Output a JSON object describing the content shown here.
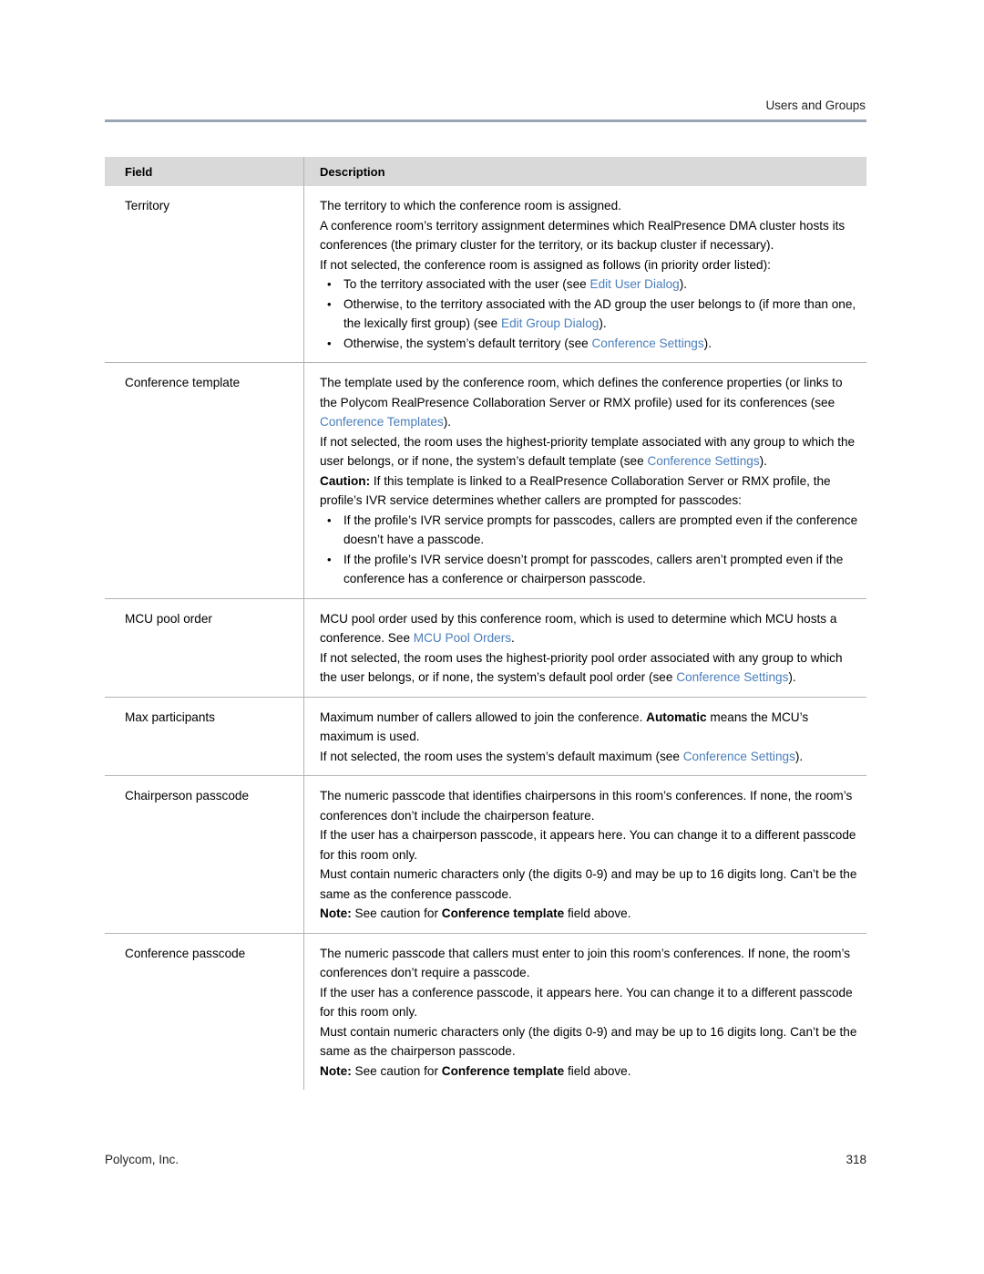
{
  "header": {
    "section_title": "Users and Groups"
  },
  "table": {
    "columns": [
      "Field",
      "Description"
    ],
    "rows": [
      {
        "field": "Territory",
        "blocks": [
          {
            "type": "p",
            "runs": [
              {
                "t": "The territory to which the conference room is assigned."
              }
            ]
          },
          {
            "type": "p",
            "runs": [
              {
                "t": "A conference room’s territory assignment determines which RealPresence DMA cluster hosts its conferences (the primary cluster for the territory, or its backup cluster if necessary)."
              }
            ]
          },
          {
            "type": "p",
            "runs": [
              {
                "t": "If not selected, the conference room is assigned as follows (in priority order listed):"
              }
            ]
          },
          {
            "type": "ul",
            "items": [
              {
                "runs": [
                  {
                    "t": "To the territory associated with the user (see "
                  },
                  {
                    "t": "Edit User Dialog",
                    "style": "link"
                  },
                  {
                    "t": ")."
                  }
                ]
              },
              {
                "runs": [
                  {
                    "t": "Otherwise, to the territory associated with the AD group the user belongs to (if more than one, the lexically first group) (see "
                  },
                  {
                    "t": "Edit Group Dialog",
                    "style": "link"
                  },
                  {
                    "t": ")."
                  }
                ]
              },
              {
                "runs": [
                  {
                    "t": "Otherwise, the system’s default territory (see "
                  },
                  {
                    "t": "Conference Settings",
                    "style": "link"
                  },
                  {
                    "t": ")."
                  }
                ]
              }
            ]
          }
        ]
      },
      {
        "field": "Conference template",
        "blocks": [
          {
            "type": "p",
            "runs": [
              {
                "t": "The template used by the conference room, which defines the conference properties (or links to the Polycom RealPresence Collaboration Server or RMX profile) used for its conferences (see "
              },
              {
                "t": "Conference Templates",
                "style": "link"
              },
              {
                "t": ")."
              }
            ]
          },
          {
            "type": "p",
            "runs": [
              {
                "t": "If not selected, the room uses the highest-priority template associated with any group to which the user belongs, or if none, the system’s default template (see "
              },
              {
                "t": "Conference Settings",
                "style": "link"
              },
              {
                "t": ")."
              }
            ]
          },
          {
            "type": "p",
            "runs": [
              {
                "t": "Caution:",
                "style": "bold"
              },
              {
                "t": " If this template is linked to a RealPresence Collaboration Server or RMX profile, the profile’s IVR service determines whether callers are prompted for passcodes:"
              }
            ]
          },
          {
            "type": "ul",
            "items": [
              {
                "runs": [
                  {
                    "t": "If the profile’s IVR service prompts for passcodes, callers are prompted even if the conference doesn’t have a passcode."
                  }
                ]
              },
              {
                "runs": [
                  {
                    "t": "If the profile’s IVR service doesn’t prompt for passcodes, callers aren’t prompted even if the conference has a conference or chairperson passcode."
                  }
                ]
              }
            ]
          }
        ]
      },
      {
        "field": "MCU pool order",
        "blocks": [
          {
            "type": "p",
            "runs": [
              {
                "t": "MCU pool order used by this conference room, which is used to determine which MCU hosts a conference. See "
              },
              {
                "t": "MCU Pool Orders",
                "style": "link"
              },
              {
                "t": "."
              }
            ]
          },
          {
            "type": "p",
            "runs": [
              {
                "t": "If not selected, the room uses the highest-priority pool order associated with any group to which the user belongs, or if none, the system’s default pool order (see "
              },
              {
                "t": "Conference Settings",
                "style": "link"
              },
              {
                "t": ")."
              }
            ]
          }
        ]
      },
      {
        "field": "Max participants",
        "blocks": [
          {
            "type": "p",
            "runs": [
              {
                "t": "Maximum number of callers allowed to join the conference. "
              },
              {
                "t": "Automatic",
                "style": "bold"
              },
              {
                "t": " means the MCU’s maximum is used."
              }
            ]
          },
          {
            "type": "p",
            "runs": [
              {
                "t": "If not selected, the room uses the system’s default maximum (see "
              },
              {
                "t": "Conference Settings",
                "style": "link"
              },
              {
                "t": ")."
              }
            ]
          }
        ]
      },
      {
        "field": "Chairperson passcode",
        "blocks": [
          {
            "type": "p",
            "runs": [
              {
                "t": "The numeric passcode that identifies chairpersons in this room’s conferences. If none, the room’s conferences don’t include the chairperson feature."
              }
            ]
          },
          {
            "type": "p",
            "runs": [
              {
                "t": "If the user has a chairperson passcode, it appears here. You can change it to a different passcode for this room only."
              }
            ]
          },
          {
            "type": "p",
            "runs": [
              {
                "t": "Must contain numeric characters only (the digits 0-9) and may be up to 16 digits long. Can’t be the same as the conference passcode."
              }
            ]
          },
          {
            "type": "p",
            "runs": [
              {
                "t": "Note:",
                "style": "bold"
              },
              {
                "t": " See caution for "
              },
              {
                "t": "Conference template",
                "style": "bold"
              },
              {
                "t": " field above."
              }
            ]
          }
        ]
      },
      {
        "field": "Conference passcode",
        "blocks": [
          {
            "type": "p",
            "runs": [
              {
                "t": "The numeric passcode that callers must enter to join this room’s conferences. If none, the room’s conferences don’t require a passcode."
              }
            ]
          },
          {
            "type": "p",
            "runs": [
              {
                "t": "If the user has a conference passcode, it appears here. You can change it to a different passcode for this room only."
              }
            ]
          },
          {
            "type": "p",
            "runs": [
              {
                "t": "Must contain numeric characters only (the digits 0-9) and may be up to 16 digits long. Can’t be the same as the chairperson passcode."
              }
            ]
          },
          {
            "type": "p",
            "runs": [
              {
                "t": "Note:",
                "style": "bold"
              },
              {
                "t": " See caution for "
              },
              {
                "t": "Conference template",
                "style": "bold"
              },
              {
                "t": " field above."
              }
            ]
          }
        ]
      }
    ]
  },
  "footer": {
    "company": "Polycom, Inc.",
    "page_number": "318"
  },
  "colors": {
    "header_rule": "#9aa6b4",
    "table_header_bg": "#d9d9d9",
    "link": "#4a7ebb",
    "border": "#b3b3b3"
  }
}
